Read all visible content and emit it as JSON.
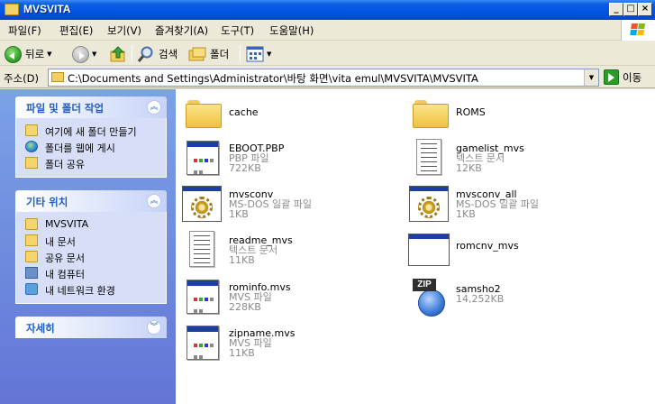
{
  "window": {
    "title": "MVSVITA",
    "minimize_label": "_",
    "maximize_label": "□",
    "close_label": "×"
  },
  "menu": [
    "파일(F)",
    "편집(E)",
    "보기(V)",
    "즐겨찾기(A)",
    "도구(T)",
    "도움말(H)"
  ],
  "toolbar": {
    "back_label": "뒤로",
    "search_label": "검색",
    "folders_label": "폴더"
  },
  "address": {
    "label": "주소(D)",
    "path": "C:\\Documents and Settings\\Administrator\\바탕 화면\\vita emul\\MVSVITA\\MVSVITA",
    "go_label": "이동"
  },
  "panels": {
    "tasks": {
      "title": "파일 및 폴더 작업",
      "items": [
        "여기에 새 폴더 만들기",
        "폴더를 웹에 게시",
        "폴더 공유"
      ]
    },
    "other_places": {
      "title": "기타 위치",
      "items": [
        "MVSVITA",
        "내 문서",
        "공유 문서",
        "내 컴퓨터",
        "내 네트워크 환경"
      ]
    },
    "details": {
      "title": "자세히"
    }
  },
  "files": [
    {
      "name": "cache",
      "type": "",
      "size": "",
      "icon": "folder"
    },
    {
      "name": "ROMS",
      "type": "",
      "size": "",
      "icon": "folder"
    },
    {
      "name": "EBOOT.PBP",
      "type": "PBP 파일",
      "size": "722KB",
      "icon": "generic-file"
    },
    {
      "name": "gamelist_mvs",
      "type": "텍스트 문서",
      "size": "12KB",
      "icon": "text-document"
    },
    {
      "name": "mvsconv",
      "type": "MS-DOS 일괄 파일",
      "size": "1KB",
      "icon": "batch-file"
    },
    {
      "name": "mvsconv_all",
      "type": "MS-DOS 일괄 파일",
      "size": "1KB",
      "icon": "batch-file"
    },
    {
      "name": "readme_mvs",
      "type": "텍스트 문서",
      "size": "11KB",
      "icon": "text-document"
    },
    {
      "name": "romcnv_mvs",
      "type": "",
      "size": "",
      "icon": "application"
    },
    {
      "name": "rominfo.mvs",
      "type": "MVS 파일",
      "size": "228KB",
      "icon": "generic-file"
    },
    {
      "name": "samsho2",
      "type": "",
      "size": "14,252KB",
      "icon": "zip-archive"
    },
    {
      "name": "zipname.mvs",
      "type": "MVS 파일",
      "size": "11KB",
      "icon": "generic-file"
    }
  ],
  "zip_badge": "ZIP"
}
